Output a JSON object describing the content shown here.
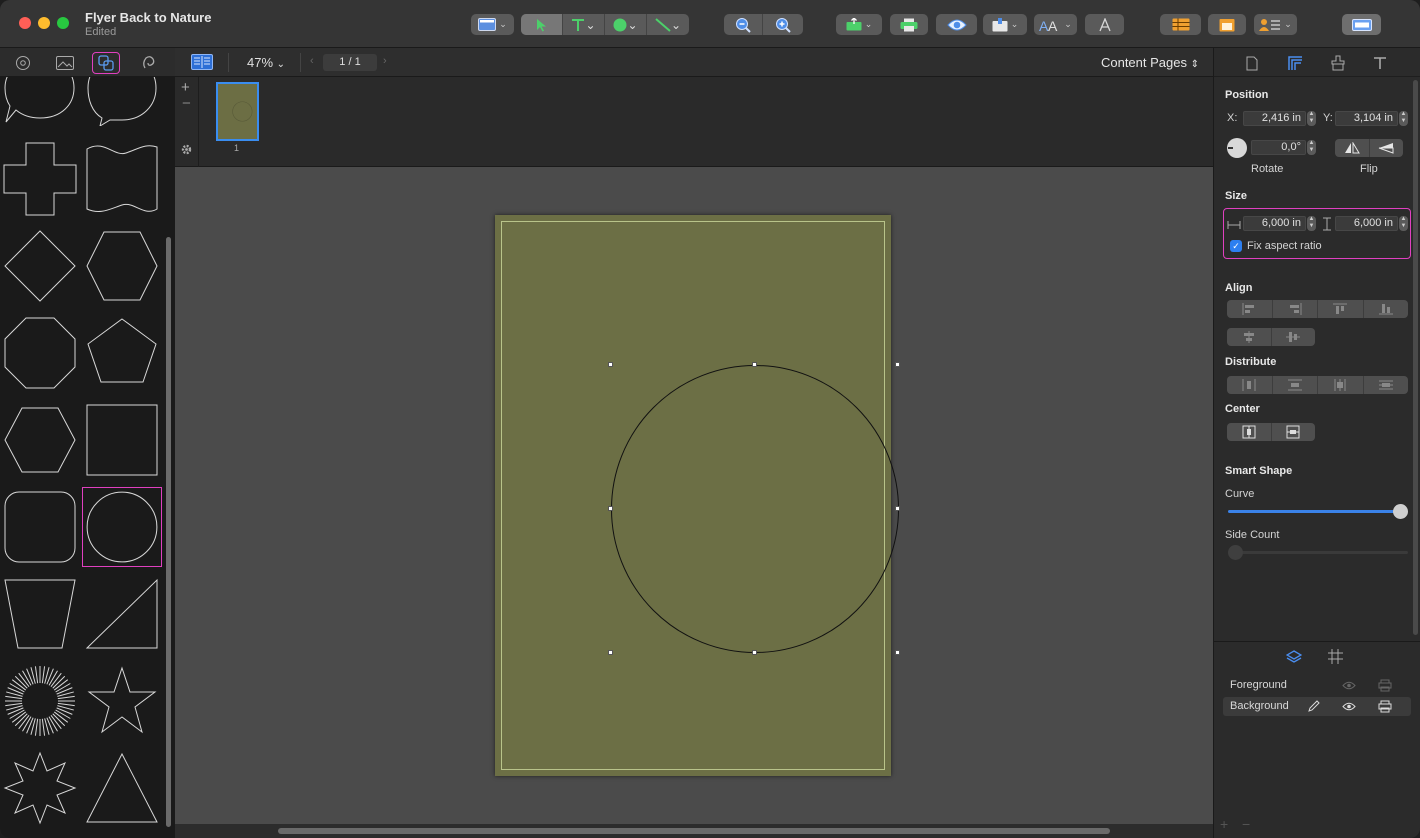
{
  "window": {
    "title": "Flyer Back to Nature",
    "subtitle": "Edited"
  },
  "canvas_bar": {
    "zoom": "47%",
    "page_indicator": "1 / 1",
    "content_pages": "Content Pages"
  },
  "thumbnails": [
    {
      "label": "1"
    }
  ],
  "inspector": {
    "position": {
      "heading": "Position",
      "x_label": "X:",
      "x_value": "2,416 in",
      "y_label": "Y:",
      "y_value": "3,104 in",
      "rotate_value": "0,0°",
      "rotate_label": "Rotate",
      "flip_label": "Flip"
    },
    "size": {
      "heading": "Size",
      "width_value": "6,000 in",
      "height_value": "6,000 in",
      "fix_aspect_label": "Fix aspect ratio",
      "fix_aspect_checked": true
    },
    "align_heading": "Align",
    "distribute_heading": "Distribute",
    "center_heading": "Center",
    "smart_shape": {
      "heading": "Smart Shape",
      "curve_label": "Curve",
      "curve_value": 1.0,
      "side_count_label": "Side Count",
      "side_count_value": 0.0
    }
  },
  "layers": [
    {
      "name": "Foreground"
    },
    {
      "name": "Background"
    }
  ],
  "colors": {
    "page_fill": "#6c6f45",
    "selection_accent": "#e040c0",
    "accent_blue": "#3a82e8"
  }
}
